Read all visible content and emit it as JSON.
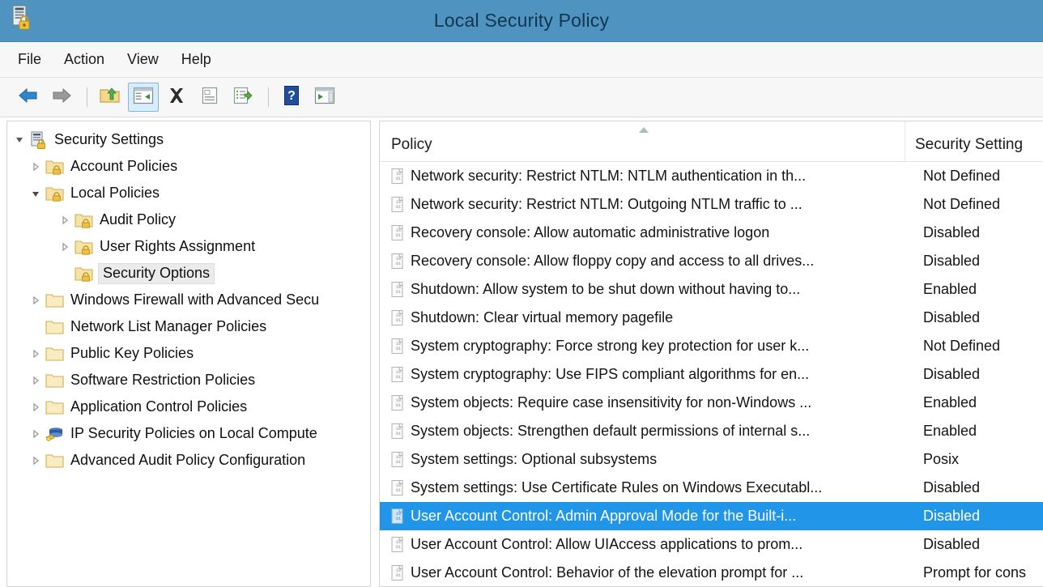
{
  "window": {
    "title": "Local Security Policy",
    "icon": "security-policy-console-icon",
    "titlebar_color": "#4f93c0",
    "selection_color": "#2196e8"
  },
  "menubar": {
    "items": [
      {
        "label": "File",
        "name": "menu-file"
      },
      {
        "label": "Action",
        "name": "menu-action"
      },
      {
        "label": "View",
        "name": "menu-view"
      },
      {
        "label": "Help",
        "name": "menu-help"
      }
    ]
  },
  "toolbar": {
    "buttons": [
      {
        "icon": "back-arrow-icon",
        "active": false
      },
      {
        "icon": "forward-arrow-icon",
        "active": false
      },
      {
        "icon": "separator",
        "active": false
      },
      {
        "icon": "up-one-level-folder-icon",
        "active": false
      },
      {
        "icon": "show-hide-console-tree-icon",
        "active": true
      },
      {
        "icon": "delete-icon",
        "active": false
      },
      {
        "icon": "properties-icon",
        "active": false
      },
      {
        "icon": "export-list-icon",
        "active": false
      },
      {
        "icon": "separator",
        "active": false
      },
      {
        "icon": "help-icon",
        "active": false
      },
      {
        "icon": "show-action-pane-icon",
        "active": false
      }
    ]
  },
  "tree": {
    "items": [
      {
        "label": "Security Settings",
        "depth": 0,
        "twisty": "expanded-root",
        "icon": "console-root-lock-icon",
        "selected": false
      },
      {
        "label": "Account Policies",
        "depth": 1,
        "twisty": "collapsed",
        "icon": "folder-lock-icon",
        "selected": false
      },
      {
        "label": "Local Policies",
        "depth": 1,
        "twisty": "expanded",
        "icon": "folder-lock-icon",
        "selected": false
      },
      {
        "label": "Audit Policy",
        "depth": 2,
        "twisty": "collapsed",
        "icon": "folder-lock-icon",
        "selected": false
      },
      {
        "label": "User Rights Assignment",
        "depth": 2,
        "twisty": "collapsed",
        "icon": "folder-lock-icon",
        "selected": false
      },
      {
        "label": "Security Options",
        "depth": 2,
        "twisty": "none",
        "icon": "folder-lock-icon",
        "selected": true
      },
      {
        "label": "Windows Firewall with Advanced Secu",
        "depth": 1,
        "twisty": "collapsed",
        "icon": "folder-icon",
        "selected": false
      },
      {
        "label": "Network List Manager Policies",
        "depth": 1,
        "twisty": "none",
        "icon": "folder-icon",
        "selected": false
      },
      {
        "label": "Public Key Policies",
        "depth": 1,
        "twisty": "collapsed",
        "icon": "folder-icon",
        "selected": false
      },
      {
        "label": "Software Restriction Policies",
        "depth": 1,
        "twisty": "collapsed",
        "icon": "folder-icon",
        "selected": false
      },
      {
        "label": "Application Control Policies",
        "depth": 1,
        "twisty": "collapsed",
        "icon": "folder-icon",
        "selected": false
      },
      {
        "label": "IP Security Policies on Local Compute",
        "depth": 1,
        "twisty": "collapsed",
        "icon": "ip-security-icon",
        "selected": false
      },
      {
        "label": "Advanced Audit Policy Configuration",
        "depth": 1,
        "twisty": "collapsed",
        "icon": "folder-icon",
        "selected": false
      }
    ]
  },
  "list": {
    "columns": [
      {
        "label": "Policy",
        "name": "column-header-policy",
        "sorted": "ascending"
      },
      {
        "label": "Security Setting",
        "name": "column-header-security-setting",
        "sorted": "none"
      }
    ],
    "rows": [
      {
        "policy": "Network security: Restrict NTLM: NTLM authentication in th...",
        "setting": "Not Defined",
        "selected": false
      },
      {
        "policy": "Network security: Restrict NTLM: Outgoing NTLM traffic to ...",
        "setting": "Not Defined",
        "selected": false
      },
      {
        "policy": "Recovery console: Allow automatic administrative logon",
        "setting": "Disabled",
        "selected": false
      },
      {
        "policy": "Recovery console: Allow floppy copy and access to all drives...",
        "setting": "Disabled",
        "selected": false
      },
      {
        "policy": "Shutdown: Allow system to be shut down without having to...",
        "setting": "Enabled",
        "selected": false
      },
      {
        "policy": "Shutdown: Clear virtual memory pagefile",
        "setting": "Disabled",
        "selected": false
      },
      {
        "policy": "System cryptography: Force strong key protection for user k...",
        "setting": "Not Defined",
        "selected": false
      },
      {
        "policy": "System cryptography: Use FIPS compliant algorithms for en...",
        "setting": "Disabled",
        "selected": false
      },
      {
        "policy": "System objects: Require case insensitivity for non-Windows ...",
        "setting": "Enabled",
        "selected": false
      },
      {
        "policy": "System objects: Strengthen default permissions of internal s...",
        "setting": "Enabled",
        "selected": false
      },
      {
        "policy": "System settings: Optional subsystems",
        "setting": "Posix",
        "selected": false
      },
      {
        "policy": "System settings: Use Certificate Rules on Windows Executabl...",
        "setting": "Disabled",
        "selected": false
      },
      {
        "policy": "User Account Control: Admin Approval Mode for the Built-i...",
        "setting": "Disabled",
        "selected": true
      },
      {
        "policy": "User Account Control: Allow UIAccess applications to prom...",
        "setting": "Disabled",
        "selected": false
      },
      {
        "policy": "User Account Control: Behavior of the elevation prompt for ...",
        "setting": "Prompt for cons",
        "selected": false
      }
    ]
  }
}
